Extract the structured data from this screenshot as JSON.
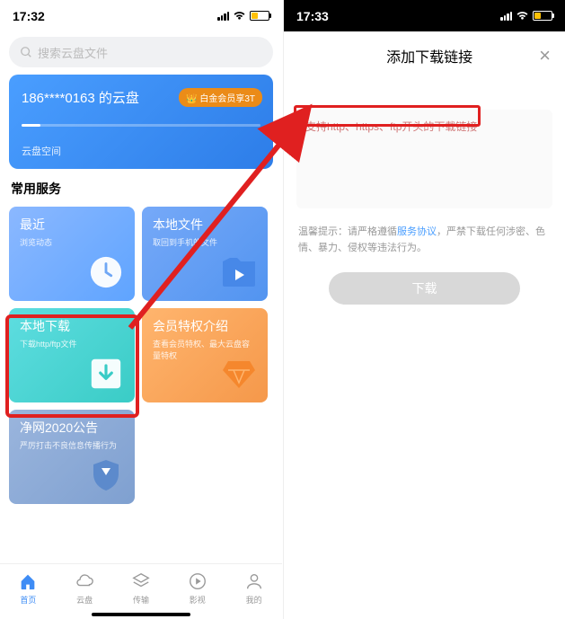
{
  "left": {
    "status_time": "17:32",
    "search_placeholder": "搜索云盘文件",
    "cloud": {
      "title": "186****0163 的云盘",
      "platinum": "👑 白金会员享3T",
      "space": "云盘空间"
    },
    "section": "常用服务",
    "tiles": {
      "recent": {
        "title": "最近",
        "sub": "浏览动态"
      },
      "local": {
        "title": "本地文件",
        "sub": "取回到手机的文件"
      },
      "download": {
        "title": "本地下载",
        "sub": "下载http/ftp文件"
      },
      "vip": {
        "title": "会员特权介绍",
        "sub": "查看会员特权、最大云盘容量特权"
      },
      "notice": {
        "title": "净网2020公告",
        "sub": "严厉打击不良信息传播行为"
      }
    },
    "tabs": {
      "home": "首页",
      "cloud": "云盘",
      "transfer": "传输",
      "video": "影视",
      "me": "我的"
    }
  },
  "right": {
    "status_time": "17:33",
    "title": "添加下载链接",
    "placeholder": "支持http、https、ftp开头的下载链接",
    "hint_prefix": "温馨提示：请严格遵循",
    "hint_link": "服务协议",
    "hint_suffix": "，严禁下载任何涉密、色情、暴力、侵权等违法行为。",
    "button": "下载"
  }
}
